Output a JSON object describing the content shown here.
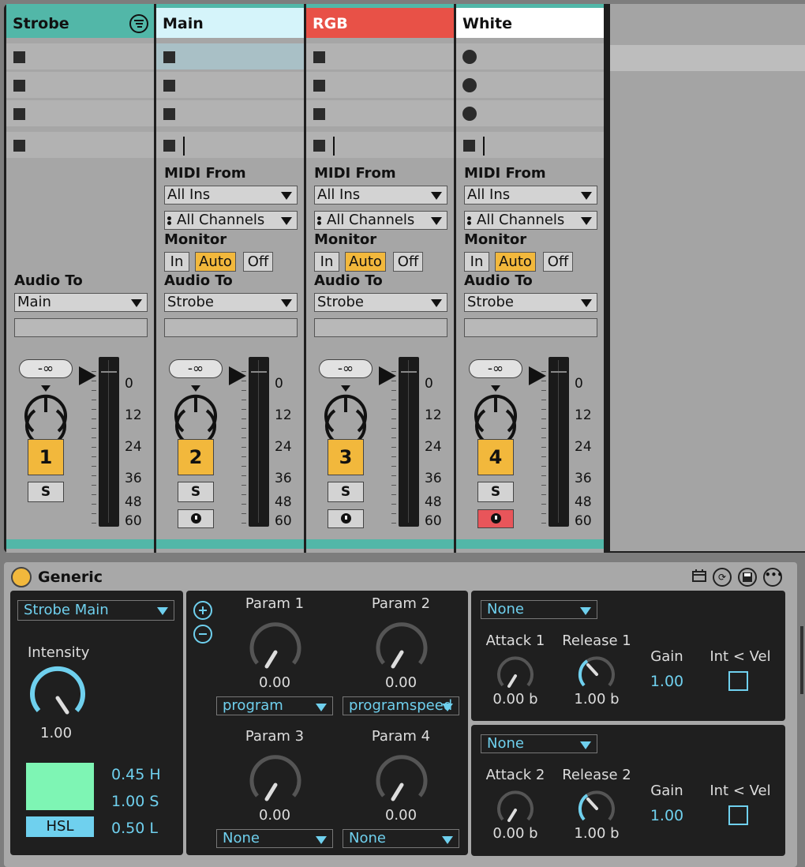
{
  "tracks": [
    {
      "name": "Strobe",
      "color": "#52b7a8",
      "text_color": "#111111",
      "type": "group",
      "slots": [
        "stop",
        "stop",
        "stop"
      ],
      "stop_all": "stop",
      "audio_to_label": "Audio To",
      "audio_to": "Main",
      "volume": "-∞",
      "number": "1",
      "solo": "S",
      "arm": false
    },
    {
      "name": "Main",
      "color": "#d5f4fa",
      "text_color": "#111111",
      "type": "midi",
      "slots": [
        "stop",
        "stop",
        "stop"
      ],
      "stop_all": "stop",
      "midi_from_label": "MIDI From",
      "midi_from": "All Ins",
      "midi_channel": "All Channels",
      "monitor_label": "Monitor",
      "monitor": [
        "In",
        "Auto",
        "Off"
      ],
      "monitor_active": "Auto",
      "audio_to_label": "Audio To",
      "audio_to": "Strobe",
      "volume": "-∞",
      "number": "2",
      "solo": "S",
      "arm": false
    },
    {
      "name": "RGB",
      "color": "#e85147",
      "text_color": "#ffffff",
      "type": "midi",
      "slots": [
        "stop",
        "stop",
        "stop"
      ],
      "stop_all": "stop",
      "midi_from_label": "MIDI From",
      "midi_from": "All Ins",
      "midi_channel": "All Channels",
      "monitor_label": "Monitor",
      "monitor": [
        "In",
        "Auto",
        "Off"
      ],
      "monitor_active": "Auto",
      "audio_to_label": "Audio To",
      "audio_to": "Strobe",
      "volume": "-∞",
      "number": "3",
      "solo": "S",
      "arm": false
    },
    {
      "name": "White",
      "color": "#ffffff",
      "text_color": "#111111",
      "type": "midi",
      "slots": [
        "record",
        "record",
        "record"
      ],
      "stop_all": "stop",
      "midi_from_label": "MIDI From",
      "midi_from": "All Ins",
      "midi_channel": "All Channels",
      "monitor_label": "Monitor",
      "monitor": [
        "In",
        "Auto",
        "Off"
      ],
      "monitor_active": "Auto",
      "audio_to_label": "Audio To",
      "audio_to": "Strobe",
      "volume": "-∞",
      "number": "4",
      "solo": "S",
      "arm": true
    }
  ],
  "meter_scale": [
    "0",
    "12",
    "24",
    "36",
    "48",
    "60"
  ],
  "device": {
    "title": "Generic",
    "header_icons": [
      "calendar-icon",
      "refresh-icon",
      "save-icon",
      "more-icon"
    ],
    "left": {
      "fixture": "Strobe Main",
      "intensity_label": "Intensity",
      "intensity_value": "1.00",
      "intensity": 1.0,
      "swatch_color": "#7ef5b4",
      "h": "0.45 H",
      "s": "1.00 S",
      "l": "0.50 L",
      "mode_button": "HSL"
    },
    "params": [
      {
        "label": "Param 1",
        "value": "0.00",
        "mapping": "program"
      },
      {
        "label": "Param 2",
        "value": "0.00",
        "mapping": "programspeed"
      },
      {
        "label": "Param 3",
        "value": "0.00",
        "mapping": "None"
      },
      {
        "label": "Param 4",
        "value": "0.00",
        "mapping": "None"
      }
    ],
    "envelopes": [
      {
        "source": "None",
        "attack_label": "Attack 1",
        "attack_value": "0.00 b",
        "release_label": "Release 1",
        "release_value": "1.00 b",
        "gain_label": "Gain",
        "gain_value": "1.00",
        "int_vel_label": "Int < Vel"
      },
      {
        "source": "None",
        "attack_label": "Attack 2",
        "attack_value": "0.00 b",
        "release_label": "Release 2",
        "release_value": "1.00 b",
        "gain_label": "Gain",
        "gain_value": "1.00",
        "int_vel_label": "Int < Vel"
      }
    ]
  }
}
